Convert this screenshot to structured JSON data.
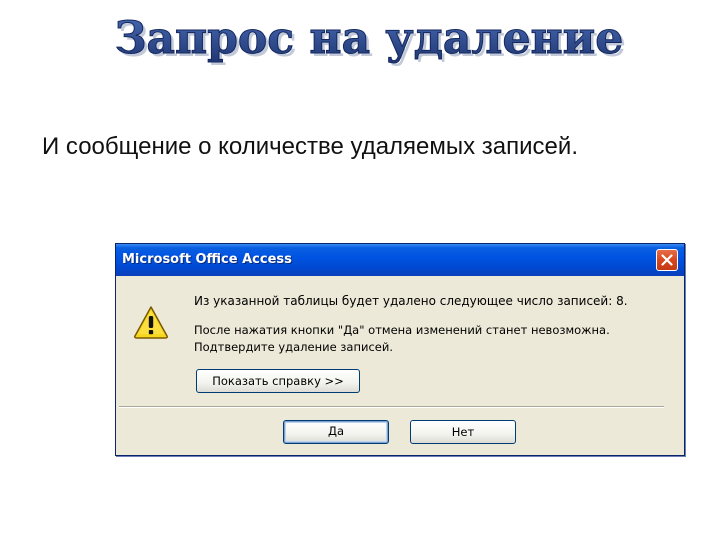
{
  "slide": {
    "title": "Запрос на удаление",
    "subtitle": "И сообщение о количестве удаляемых записей."
  },
  "dialog": {
    "title": "Microsoft Office Access",
    "message_main": "Из указанной таблицы будет удалено следующее число записей: 8.",
    "message_detail_1": "После нажатия кнопки \"Да\" отмена изменений станет невозможна.",
    "message_detail_2": "Подтвердите удаление записей.",
    "help_button": "Показать справку >>",
    "yes_button": "Да",
    "no_button": "Нет",
    "icon": "warning-icon",
    "close_icon": "close-icon"
  },
  "colors": {
    "title_fill": "#2e4a8c",
    "titlebar": "#0054e3",
    "dialog_bg": "#ece9d8",
    "warning_yellow": "#f7d61e"
  }
}
